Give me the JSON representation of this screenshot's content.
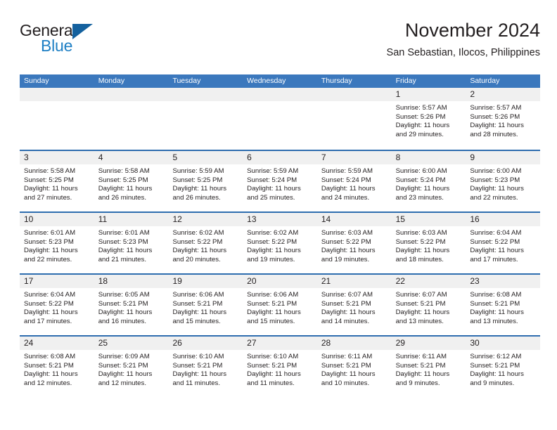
{
  "logo": {
    "word_top": "General",
    "word_bottom": "Blue",
    "triangle_icon": "blue-triangle-icon",
    "colors": {
      "text": "#231f20",
      "blue": "#1e7fc4",
      "triangle": "#14619e"
    }
  },
  "header": {
    "title": "November 2024",
    "subtitle": "San Sebastian, Ilocos, Philippines"
  },
  "colors": {
    "header_bar": "#3b78bd",
    "row_divider": "#2e6daf",
    "day_band": "#f0f0f0",
    "page_background": "#ffffff"
  },
  "weekdays": [
    "Sunday",
    "Monday",
    "Tuesday",
    "Wednesday",
    "Thursday",
    "Friday",
    "Saturday"
  ],
  "weeks": [
    [
      {
        "day": "",
        "empty": true
      },
      {
        "day": "",
        "empty": true
      },
      {
        "day": "",
        "empty": true
      },
      {
        "day": "",
        "empty": true
      },
      {
        "day": "",
        "empty": true
      },
      {
        "day": "1",
        "sunrise": "Sunrise: 5:57 AM",
        "sunset": "Sunset: 5:26 PM",
        "daylight": "Daylight: 11 hours and 29 minutes."
      },
      {
        "day": "2",
        "sunrise": "Sunrise: 5:57 AM",
        "sunset": "Sunset: 5:26 PM",
        "daylight": "Daylight: 11 hours and 28 minutes."
      }
    ],
    [
      {
        "day": "3",
        "sunrise": "Sunrise: 5:58 AM",
        "sunset": "Sunset: 5:25 PM",
        "daylight": "Daylight: 11 hours and 27 minutes."
      },
      {
        "day": "4",
        "sunrise": "Sunrise: 5:58 AM",
        "sunset": "Sunset: 5:25 PM",
        "daylight": "Daylight: 11 hours and 26 minutes."
      },
      {
        "day": "5",
        "sunrise": "Sunrise: 5:59 AM",
        "sunset": "Sunset: 5:25 PM",
        "daylight": "Daylight: 11 hours and 26 minutes."
      },
      {
        "day": "6",
        "sunrise": "Sunrise: 5:59 AM",
        "sunset": "Sunset: 5:24 PM",
        "daylight": "Daylight: 11 hours and 25 minutes."
      },
      {
        "day": "7",
        "sunrise": "Sunrise: 5:59 AM",
        "sunset": "Sunset: 5:24 PM",
        "daylight": "Daylight: 11 hours and 24 minutes."
      },
      {
        "day": "8",
        "sunrise": "Sunrise: 6:00 AM",
        "sunset": "Sunset: 5:24 PM",
        "daylight": "Daylight: 11 hours and 23 minutes."
      },
      {
        "day": "9",
        "sunrise": "Sunrise: 6:00 AM",
        "sunset": "Sunset: 5:23 PM",
        "daylight": "Daylight: 11 hours and 22 minutes."
      }
    ],
    [
      {
        "day": "10",
        "sunrise": "Sunrise: 6:01 AM",
        "sunset": "Sunset: 5:23 PM",
        "daylight": "Daylight: 11 hours and 22 minutes."
      },
      {
        "day": "11",
        "sunrise": "Sunrise: 6:01 AM",
        "sunset": "Sunset: 5:23 PM",
        "daylight": "Daylight: 11 hours and 21 minutes."
      },
      {
        "day": "12",
        "sunrise": "Sunrise: 6:02 AM",
        "sunset": "Sunset: 5:22 PM",
        "daylight": "Daylight: 11 hours and 20 minutes."
      },
      {
        "day": "13",
        "sunrise": "Sunrise: 6:02 AM",
        "sunset": "Sunset: 5:22 PM",
        "daylight": "Daylight: 11 hours and 19 minutes."
      },
      {
        "day": "14",
        "sunrise": "Sunrise: 6:03 AM",
        "sunset": "Sunset: 5:22 PM",
        "daylight": "Daylight: 11 hours and 19 minutes."
      },
      {
        "day": "15",
        "sunrise": "Sunrise: 6:03 AM",
        "sunset": "Sunset: 5:22 PM",
        "daylight": "Daylight: 11 hours and 18 minutes."
      },
      {
        "day": "16",
        "sunrise": "Sunrise: 6:04 AM",
        "sunset": "Sunset: 5:22 PM",
        "daylight": "Daylight: 11 hours and 17 minutes."
      }
    ],
    [
      {
        "day": "17",
        "sunrise": "Sunrise: 6:04 AM",
        "sunset": "Sunset: 5:22 PM",
        "daylight": "Daylight: 11 hours and 17 minutes."
      },
      {
        "day": "18",
        "sunrise": "Sunrise: 6:05 AM",
        "sunset": "Sunset: 5:21 PM",
        "daylight": "Daylight: 11 hours and 16 minutes."
      },
      {
        "day": "19",
        "sunrise": "Sunrise: 6:06 AM",
        "sunset": "Sunset: 5:21 PM",
        "daylight": "Daylight: 11 hours and 15 minutes."
      },
      {
        "day": "20",
        "sunrise": "Sunrise: 6:06 AM",
        "sunset": "Sunset: 5:21 PM",
        "daylight": "Daylight: 11 hours and 15 minutes."
      },
      {
        "day": "21",
        "sunrise": "Sunrise: 6:07 AM",
        "sunset": "Sunset: 5:21 PM",
        "daylight": "Daylight: 11 hours and 14 minutes."
      },
      {
        "day": "22",
        "sunrise": "Sunrise: 6:07 AM",
        "sunset": "Sunset: 5:21 PM",
        "daylight": "Daylight: 11 hours and 13 minutes."
      },
      {
        "day": "23",
        "sunrise": "Sunrise: 6:08 AM",
        "sunset": "Sunset: 5:21 PM",
        "daylight": "Daylight: 11 hours and 13 minutes."
      }
    ],
    [
      {
        "day": "24",
        "sunrise": "Sunrise: 6:08 AM",
        "sunset": "Sunset: 5:21 PM",
        "daylight": "Daylight: 11 hours and 12 minutes."
      },
      {
        "day": "25",
        "sunrise": "Sunrise: 6:09 AM",
        "sunset": "Sunset: 5:21 PM",
        "daylight": "Daylight: 11 hours and 12 minutes."
      },
      {
        "day": "26",
        "sunrise": "Sunrise: 6:10 AM",
        "sunset": "Sunset: 5:21 PM",
        "daylight": "Daylight: 11 hours and 11 minutes."
      },
      {
        "day": "27",
        "sunrise": "Sunrise: 6:10 AM",
        "sunset": "Sunset: 5:21 PM",
        "daylight": "Daylight: 11 hours and 11 minutes."
      },
      {
        "day": "28",
        "sunrise": "Sunrise: 6:11 AM",
        "sunset": "Sunset: 5:21 PM",
        "daylight": "Daylight: 11 hours and 10 minutes."
      },
      {
        "day": "29",
        "sunrise": "Sunrise: 6:11 AM",
        "sunset": "Sunset: 5:21 PM",
        "daylight": "Daylight: 11 hours and 9 minutes."
      },
      {
        "day": "30",
        "sunrise": "Sunrise: 6:12 AM",
        "sunset": "Sunset: 5:21 PM",
        "daylight": "Daylight: 11 hours and 9 minutes."
      }
    ]
  ]
}
